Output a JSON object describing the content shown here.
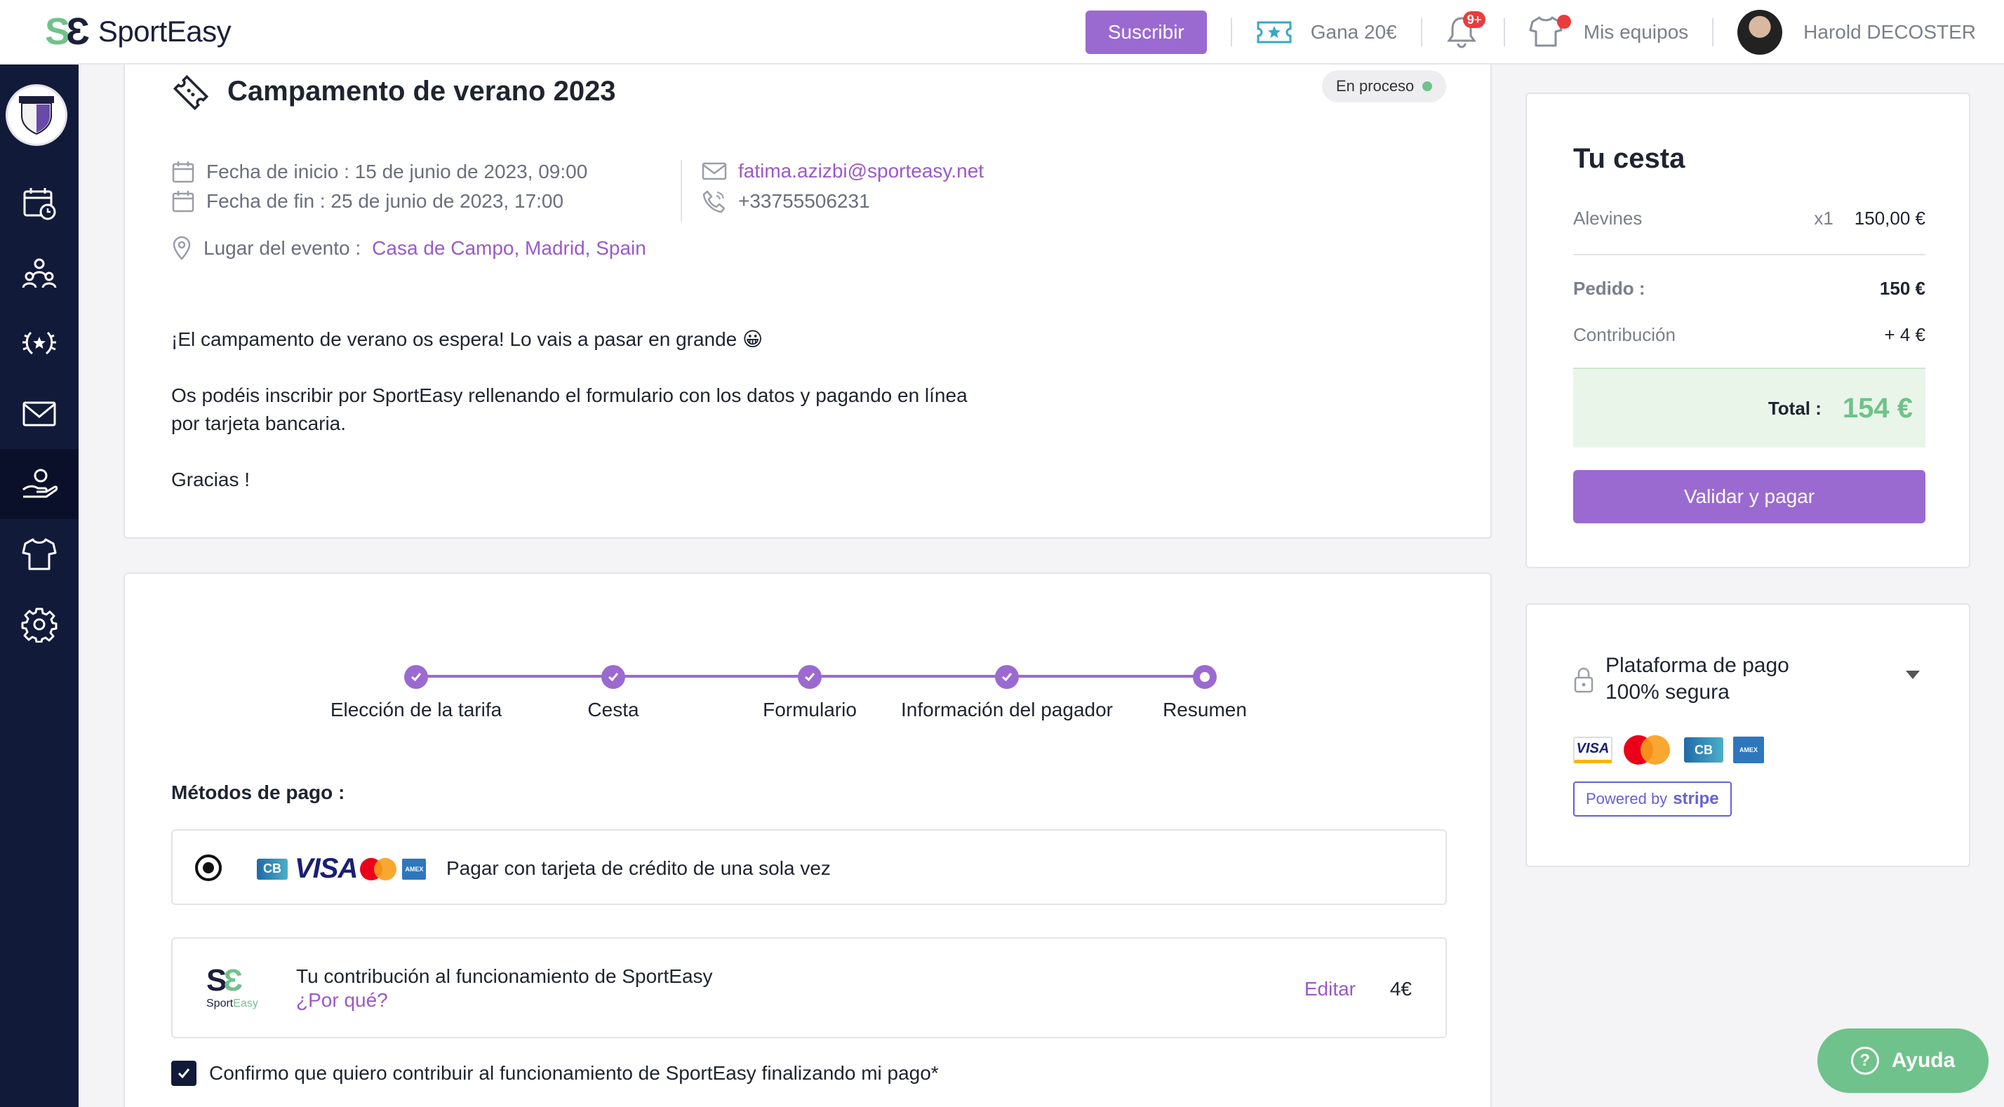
{
  "brand": {
    "logo_text": "SportEasy",
    "logo_mark": "SE"
  },
  "topbar": {
    "subscribe_label": "Suscribir",
    "earn_label": "Gana 20€",
    "notifications_count": "9+",
    "teams_label": "Mis equipos",
    "user_name": "Harold DECOSTER"
  },
  "event": {
    "title": "Campamento de verano 2023",
    "status": "En proceso",
    "start": "Fecha de inicio : 15 de junio de 2023, 09:00",
    "end": "Fecha de fin : 25 de junio de 2023, 17:00",
    "email": "fatima.azizbi@sporteasy.net",
    "phone": "+33755506231",
    "location_label": "Lugar del evento :",
    "location_value": "Casa de Campo, Madrid, Spain",
    "description_1": "¡El campamento de verano os espera! Lo vais a pasar en grande 😀",
    "description_2a": "Os podéis inscribir por SportEasy rellenando el formulario con los datos y pagando en línea",
    "description_2b": "por tarjeta bancaria.",
    "description_3": "Gracias !"
  },
  "stepper": {
    "steps": [
      {
        "label": "Elección de la tarifa",
        "state": "done"
      },
      {
        "label": "Cesta",
        "state": "done"
      },
      {
        "label": "Formulario",
        "state": "done"
      },
      {
        "label": "Información del pagador",
        "state": "done"
      },
      {
        "label": "Resumen",
        "state": "current"
      }
    ]
  },
  "payment": {
    "methods_label": "Métodos de pago :",
    "card_option_label": "Pagar con tarjeta de crédito de una sola vez",
    "card_brands": [
      "CB",
      "VISA",
      "Mastercard",
      "American Express"
    ],
    "contribution_title": "Tu contribución al funcionamiento de SportEasy",
    "contribution_why": "¿Por qué?",
    "contribution_edit": "Editar",
    "contribution_amount": "4€",
    "confirm_label": "Confirmo que quiero contribuir al funcionamiento de SportEasy finalizando mi pago*",
    "confirm_checked": true
  },
  "cart": {
    "title": "Tu cesta",
    "item_name": "Alevines",
    "item_qty": "x1",
    "item_price": "150,00 €",
    "order_label": "Pedido :",
    "order_value": "150 €",
    "contribution_label": "Contribución",
    "contribution_value": "+ 4 €",
    "total_label": "Total :",
    "total_value": "154 €",
    "pay_button": "Validar y pagar"
  },
  "secure": {
    "title_line1": "Plataforma de pago",
    "title_line2": "100% segura",
    "powered_by": "Powered by",
    "stripe": "stripe",
    "visa_mini": "VISA",
    "cb_mini": "CB"
  },
  "help": {
    "label": "Ayuda"
  },
  "colors": {
    "accent": "#9b6ad0",
    "brand_green": "#6fc28b",
    "sidebar": "#121a3a",
    "link": "#9b59c9"
  },
  "sidebar": {
    "items": [
      "calendar-icon",
      "members-icon",
      "trophy-icon",
      "mail-icon",
      "payment-icon",
      "jersey-icon",
      "settings-icon"
    ],
    "active": "payment-icon"
  }
}
